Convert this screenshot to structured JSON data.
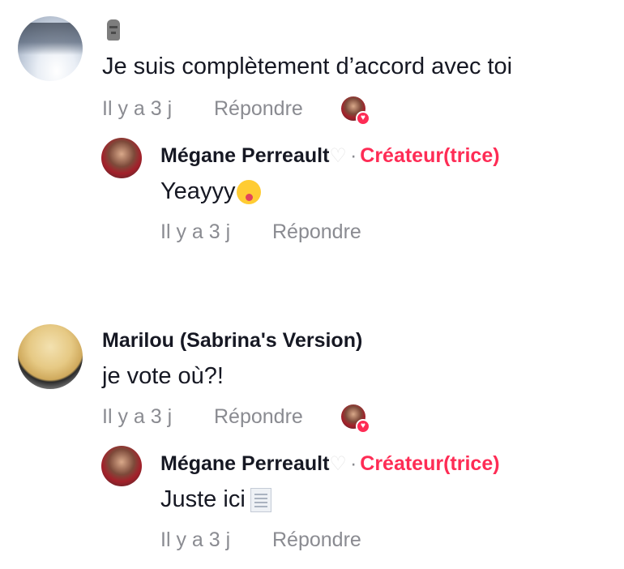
{
  "comments": [
    {
      "author": "",
      "text": "Je suis complètement d’accord avec toi",
      "time": "Il y a 3 j",
      "reply": "Répondre",
      "creator_reply": {
        "author": "Mégane Perreault",
        "badge": "Créateur(trice)",
        "text": "Yeayyy",
        "time": "Il y a 3 j",
        "reply": "Répondre"
      }
    },
    {
      "author": "Marilou (Sabrina's Version)",
      "text": "je vote où?!",
      "time": "Il y a 3 j",
      "reply": "Répondre",
      "creator_reply": {
        "author": "Mégane Perreault",
        "badge": "Créateur(trice)",
        "text": "Juste ici",
        "time": "Il y a 3 j",
        "reply": "Répondre"
      }
    }
  ],
  "separator": "·",
  "colors": {
    "accent": "#fe2c55",
    "text": "#161823",
    "muted": "#8a8b91"
  },
  "icons": [
    "moai-emoji-icon",
    "white-heart-icon",
    "squinting-tongue-emoji-icon",
    "document-emoji-icon",
    "creator-liked-icon"
  ]
}
